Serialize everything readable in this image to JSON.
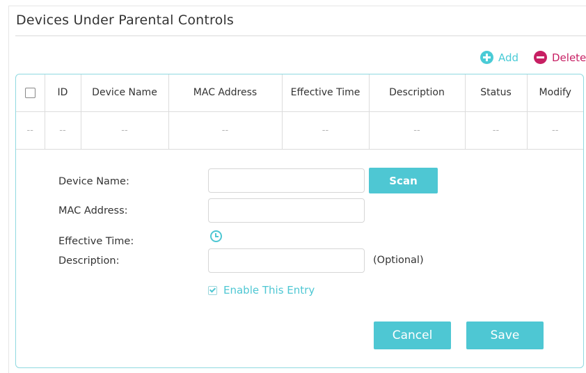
{
  "section": {
    "title": "Devices Under Parental Controls"
  },
  "toolbar": {
    "add_label": "Add",
    "add_icon": "plus-circle-icon",
    "add_color": "#4acbd6",
    "delete_label": "Delete",
    "delete_icon": "minus-circle-icon",
    "delete_color": "#c71f63"
  },
  "table": {
    "columns": [
      "",
      "ID",
      "Device Name",
      "MAC Address",
      "Effective Time",
      "Description",
      "Status",
      "Modify"
    ],
    "rows": [
      [
        "--",
        "--",
        "--",
        "--",
        "--",
        "--",
        "--",
        "--"
      ]
    ]
  },
  "form": {
    "device_name_label": "Device Name:",
    "device_name_value": "",
    "scan_label": "Scan",
    "mac_address_label": "MAC Address:",
    "mac_address_value": "",
    "effective_time_label": "Effective Time:",
    "effective_time_icon": "clock-icon",
    "description_label": "Description:",
    "description_value": "",
    "optional_note": "(Optional)",
    "enable_entry_label": "Enable This Entry",
    "enable_entry_checked": true,
    "cancel_label": "Cancel",
    "save_label": "Save"
  },
  "colors": {
    "accent": "#4ec7d3",
    "panel_border": "#8fd9e0"
  }
}
